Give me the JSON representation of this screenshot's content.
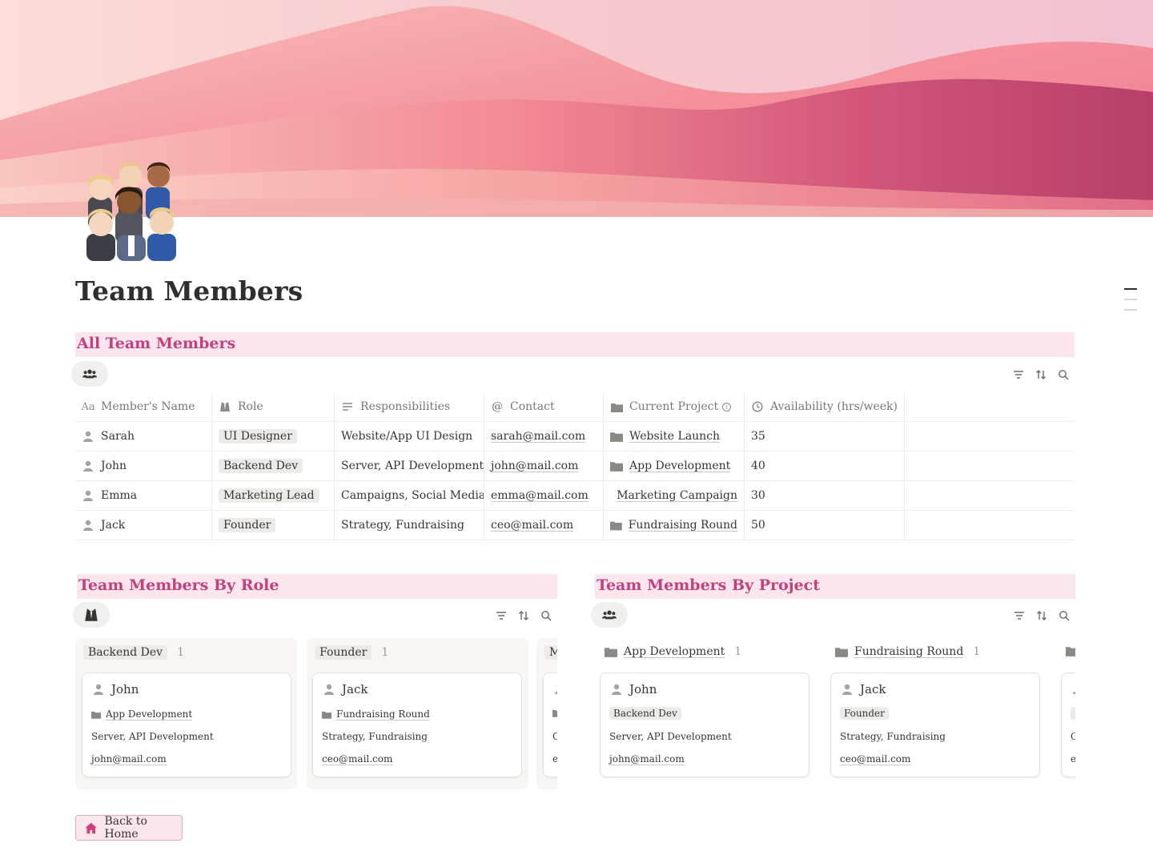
{
  "page": {
    "title": "Team Members",
    "icon": "family-group-emoji-icon"
  },
  "colors": {
    "accent": "#c4407c",
    "section_bg": "#fbe6ee",
    "tag_bg": "#ecebe8",
    "border": "#ededeb"
  },
  "all_members": {
    "heading": "All Team Members",
    "view_icon": "people-icon",
    "columns": [
      {
        "label": "Member's Name",
        "icon": "text-icon"
      },
      {
        "label": "Role",
        "icon": "suit-icon"
      },
      {
        "label": "Responsibilities",
        "icon": "lines-icon"
      },
      {
        "label": "Contact",
        "icon": "at-icon"
      },
      {
        "label": "Current Project",
        "icon": "folder-icon",
        "info": "i"
      },
      {
        "label": "Availability (hrs/week)",
        "icon": "clock-icon"
      }
    ],
    "rows": [
      {
        "name": "Sarah",
        "role": "UI Designer",
        "resp": "Website/App UI Design",
        "contact": "sarah@mail.com",
        "project": "Website Launch",
        "avail": "35"
      },
      {
        "name": "John",
        "role": "Backend Dev",
        "resp": "Server, API Development",
        "contact": "john@mail.com",
        "project": "App Development",
        "avail": "40"
      },
      {
        "name": "Emma",
        "role": "Marketing Lead",
        "resp": "Campaigns, Social Media",
        "contact": "emma@mail.com",
        "project": "Marketing Campaign",
        "avail": "30"
      },
      {
        "name": "Jack",
        "role": "Founder",
        "resp": "Strategy, Fundraising",
        "contact": "ceo@mail.com",
        "project": "Fundraising Round",
        "avail": "50"
      }
    ]
  },
  "by_role": {
    "heading": "Team Members By Role",
    "groups": [
      {
        "label": "Backend Dev",
        "count": "1",
        "card": {
          "name": "John",
          "project": "App Development",
          "resp": "Server, API Development",
          "contact": "john@mail.com"
        }
      },
      {
        "label": "Founder",
        "count": "1",
        "card": {
          "name": "Jack",
          "project": "Fundraising Round",
          "resp": "Strategy, Fundraising",
          "contact": "ceo@mail.com"
        }
      },
      {
        "label": "M",
        "count": "",
        "card": {
          "name": "",
          "project": "",
          "resp": "C",
          "contact": "e"
        }
      }
    ]
  },
  "by_project": {
    "heading": "Team Members By Project",
    "groups": [
      {
        "label": "App Development",
        "count": "1",
        "card": {
          "name": "John",
          "role": "Backend Dev",
          "resp": "Server, API Development",
          "contact": "john@mail.com"
        }
      },
      {
        "label": "Fundraising Round",
        "count": "1",
        "card": {
          "name": "Jack",
          "role": "Founder",
          "resp": "Strategy, Fundraising",
          "contact": "ceo@mail.com"
        }
      },
      {
        "label": "",
        "count": "",
        "card": {
          "name": "",
          "role": "",
          "resp": "C",
          "contact": "e"
        }
      }
    ]
  },
  "back_button": {
    "label": "Back to Home",
    "icon": "home-icon"
  }
}
